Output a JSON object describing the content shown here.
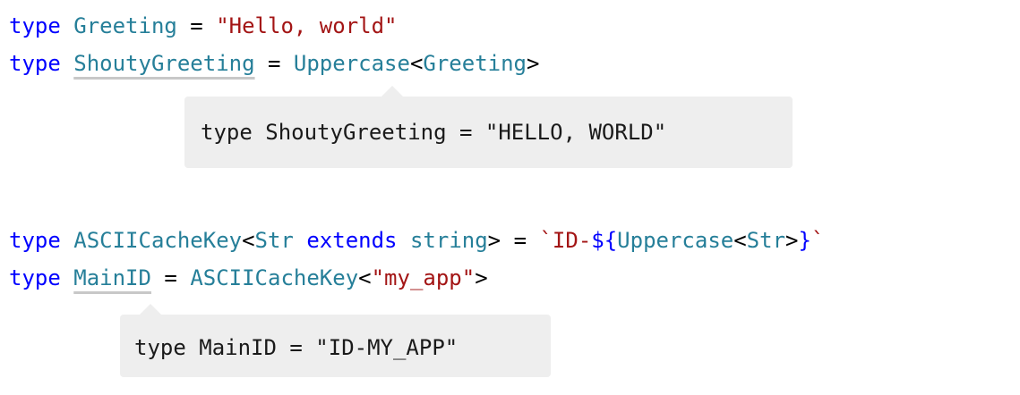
{
  "code": {
    "line1": {
      "kw_type": "type",
      "name": "Greeting",
      "eq": " = ",
      "value": "\"Hello, world\""
    },
    "line2": {
      "kw_type": "type",
      "name": "ShoutyGreeting",
      "eq": " = ",
      "fn": "Uppercase",
      "lt": "<",
      "arg": "Greeting",
      "gt": ">"
    },
    "line3": {
      "kw_type": "type",
      "name": "ASCIICacheKey",
      "lt": "<",
      "param": "Str",
      "kw_extends": "extends",
      "constraint": "string",
      "gt_eq": "> = ",
      "tpl_start": "`ID-",
      "tpl_open": "${",
      "fn": "Uppercase",
      "inner_lt": "<",
      "inner_arg": "Str",
      "inner_gt": ">",
      "tpl_close": "}",
      "tpl_end": "`"
    },
    "line4": {
      "kw_type": "type",
      "name": "MainID",
      "eq": " = ",
      "fn": "ASCIICacheKey",
      "lt": "<",
      "arg": "\"my_app\"",
      "gt": ">"
    }
  },
  "popovers": {
    "shouty": "type ShoutyGreeting = \"HELLO, WORLD\"",
    "mainid": "type MainID = \"ID-MY_APP\""
  },
  "colors": {
    "keyword": "#0000ff",
    "type_name": "#267f99",
    "string": "#a31515",
    "popover_bg": "#eeeeee"
  }
}
